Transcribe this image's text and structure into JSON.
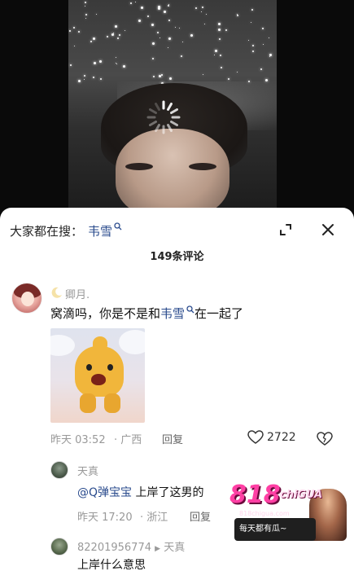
{
  "panel": {
    "search_label": "大家都在搜：",
    "search_keyword": "韦雪",
    "comment_count": "149条评论"
  },
  "comments": [
    {
      "username": "卿月.",
      "text_before": "窝滴吗，你是不是和",
      "text_link": "韦雪",
      "text_after": "在一起了",
      "time": "昨天 03:52",
      "location": "· 广西",
      "reply_label": "回复",
      "likes": "2722"
    }
  ],
  "replies": [
    {
      "username": "天真",
      "mention": "@Q弹宝宝",
      "text": "上岸了这男的",
      "time": "昨天 17:20",
      "location": "· 浙江",
      "reply_label": "回复"
    },
    {
      "username": "82201956774",
      "reply_arrow": "▶",
      "reply_to": "天真",
      "text": "上岸什么意思"
    }
  ],
  "watermark": {
    "brand_number": "818",
    "brand_name": "chiGUA",
    "site": "818chigua.com",
    "slogan": "每天都有瓜~"
  }
}
